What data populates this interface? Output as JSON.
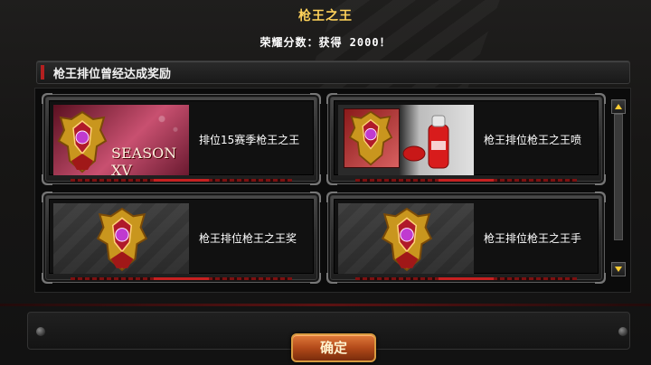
{
  "dialog": {
    "title": "枪王之王",
    "score_text": "荣耀分数：获得 2000！"
  },
  "section": {
    "label": "枪王排位曾经达成奖励"
  },
  "rewards": [
    {
      "name": "排位15赛季枪王之王",
      "season_text": "SEASON XV",
      "icon": "season-xv-emblem"
    },
    {
      "name": "枪王排位枪王之王喷",
      "icon": "emblem-with-spray-can"
    },
    {
      "name": "枪王排位枪王之王奖",
      "icon": "gold-emblem"
    },
    {
      "name": "枪王排位枪王之王手",
      "icon": "gold-emblem"
    }
  ],
  "scrollbar": {
    "up_icon": "arrow-up-icon",
    "down_icon": "arrow-down-icon"
  },
  "confirm_button": {
    "label": "确定"
  },
  "colors": {
    "title": "#ffd25a",
    "accent_red": "#b42020",
    "button": "#b34a1a"
  }
}
